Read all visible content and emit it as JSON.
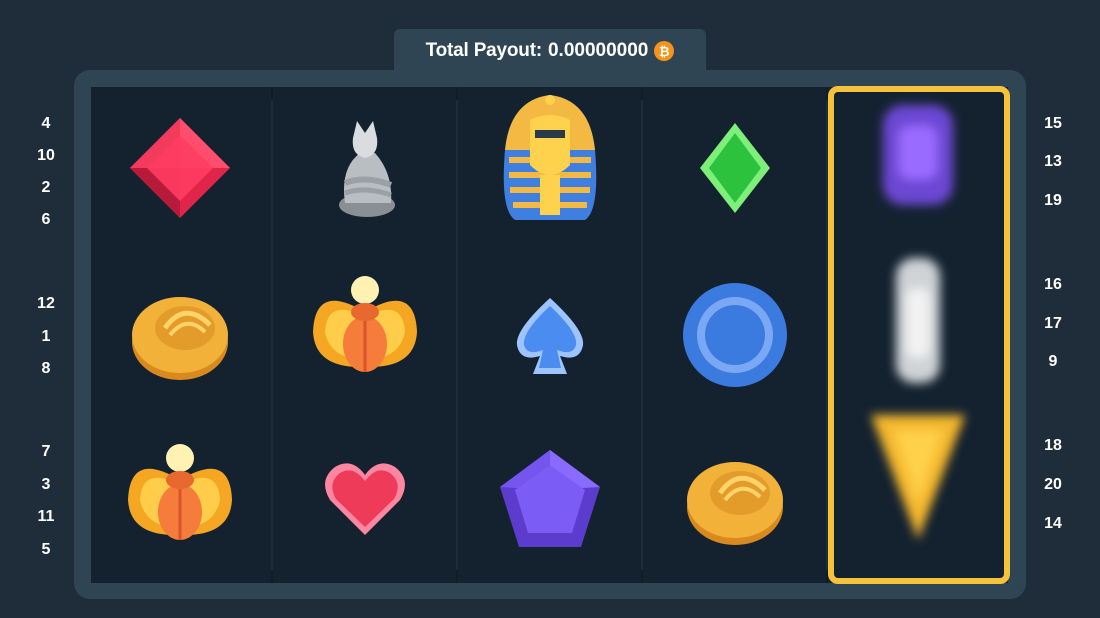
{
  "payout": {
    "label": "Total Payout:",
    "amount": "0.00000000",
    "currency_icon": "bitcoin-icon",
    "currency_symbol": "₿"
  },
  "reels": [
    [
      "red-gem",
      "cat-statue",
      "pharaoh-mask"
    ],
    [
      "gold-coin",
      "scarab",
      "blue-spade"
    ],
    [
      "scarab",
      "pink-heart",
      "purple-gem"
    ]
  ],
  "reel_columns": [
    [
      "red-gem",
      "gold-coin",
      "scarab"
    ],
    [
      "cat-statue",
      "scarab",
      "pink-heart"
    ],
    [
      "pharaoh-mask",
      "blue-spade",
      "purple-gem"
    ],
    [
      "green-diamond",
      "blue-coin",
      "gold-coin"
    ],
    [
      "purple-blur",
      "white-blur",
      "gold-triangle-blur"
    ]
  ],
  "left_numbers": [
    "4",
    "10",
    "2",
    "6",
    "12",
    "1",
    "8",
    "7",
    "3",
    "11",
    "5"
  ],
  "right_numbers": [
    "15",
    "13",
    "19",
    "16",
    "17",
    "9",
    "18",
    "20",
    "14"
  ],
  "colors": {
    "background": "#1f2d3a",
    "frame": "#2f4553",
    "board": "#0f1d28",
    "highlight": "#f5c33b",
    "btc": "#f7931a"
  }
}
